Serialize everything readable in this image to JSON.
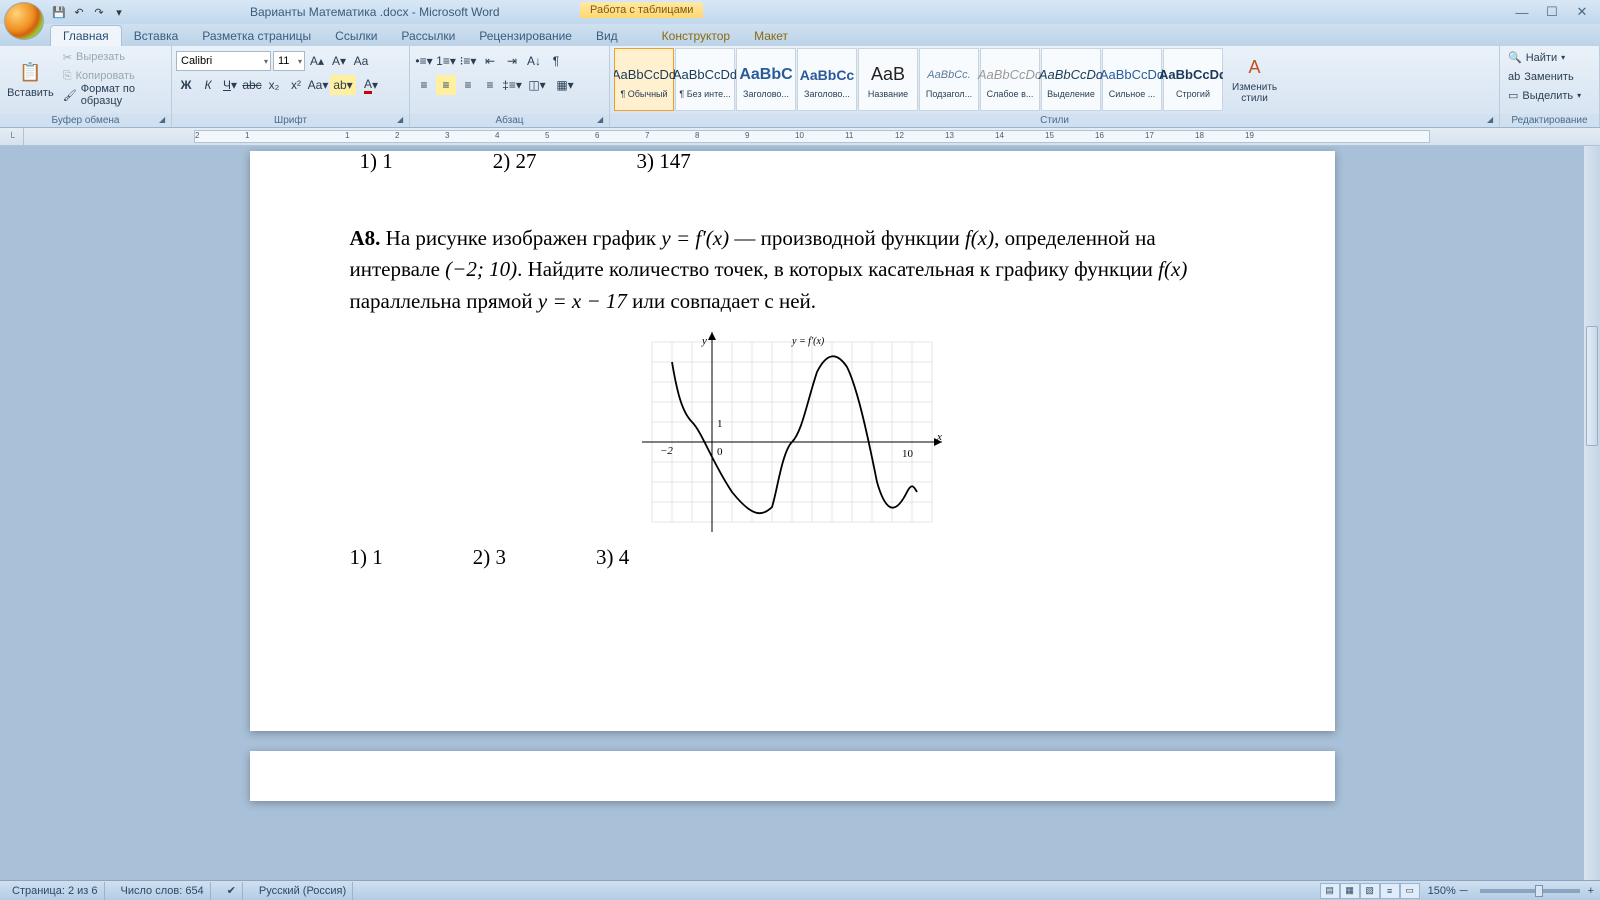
{
  "titlebar": {
    "doc_title": "Варианты Математика .docx - Microsoft Word",
    "table_tools": "Работа с таблицами"
  },
  "tabs": {
    "home": "Главная",
    "insert": "Вставка",
    "page_layout": "Разметка страницы",
    "references": "Ссылки",
    "mailings": "Рассылки",
    "review": "Рецензирование",
    "view": "Вид",
    "design": "Конструктор",
    "layout": "Макет"
  },
  "ribbon": {
    "paste": "Вставить",
    "cut": "Вырезать",
    "copy": "Копировать",
    "format_painter": "Формат по образцу",
    "clipboard_label": "Буфер обмена",
    "font_name": "Calibri",
    "font_size": "11",
    "font_label": "Шрифт",
    "para_label": "Абзац",
    "styles_label": "Стили",
    "change_styles": "Изменить\nстили",
    "find": "Найти",
    "replace": "Заменить",
    "select": "Выделить",
    "editing_label": "Редактирование",
    "styles": [
      {
        "preview": "AaBbCcDd",
        "name": "¶ Обычный",
        "cls": ""
      },
      {
        "preview": "AaBbCcDd",
        "name": "¶ Без инте...",
        "cls": ""
      },
      {
        "preview": "AaBbC",
        "name": "Заголово...",
        "cls": "h1"
      },
      {
        "preview": "AaBbCc",
        "name": "Заголово...",
        "cls": "h2"
      },
      {
        "preview": "AaB",
        "name": "Название",
        "cls": "title"
      },
      {
        "preview": "AaBbCc.",
        "name": "Подзагол...",
        "cls": "sub"
      },
      {
        "preview": "AaBbCcDd",
        "name": "Слабое в...",
        "cls": "faint"
      },
      {
        "preview": "AaBbCcDd",
        "name": "Выделение",
        "cls": "emph"
      },
      {
        "preview": "AaBbCcDd",
        "name": "Сильное ...",
        "cls": "strong"
      },
      {
        "preview": "AaBbCcDd",
        "name": "Строгий",
        "cls": "strict"
      }
    ]
  },
  "ruler_marks": [
    "2",
    "1",
    "",
    "1",
    "2",
    "3",
    "4",
    "5",
    "6",
    "7",
    "8",
    "9",
    "10",
    "11",
    "12",
    "13",
    "14",
    "15",
    "16",
    "17",
    "18",
    "19"
  ],
  "document": {
    "top_fragments": [
      "1) 1",
      "2) 27",
      "3) 147"
    ],
    "task_label": "A8.",
    "task_text_1": " На рисунке изображен график ",
    "eq1": "y = f′(x)",
    "task_text_2": " — производной функции ",
    "eq2": "f(x)",
    "task_text_3": ", определенной на интервале ",
    "interval": "(−2; 10)",
    "task_text_4": ". Найдите количество точек, в которых касательная к графику функции ",
    "eq3": "f(x)",
    "task_text_5": " параллельна прямой ",
    "eq4": "y = x − 17",
    "task_text_6": " или совпадает с ней.",
    "graph_label_y": "y",
    "graph_label_x": "x",
    "graph_label_fn": "y = f′(x)",
    "graph_tick_neg2": "−2",
    "graph_tick_1": "1",
    "graph_tick_0": "0",
    "graph_tick_10": "10",
    "answers": [
      "1) 1",
      "2) 3",
      "3) 4"
    ]
  },
  "status": {
    "page": "Страница: 2 из 6",
    "words": "Число слов: 654",
    "lang": "Русский (Россия)",
    "zoom": "150%"
  },
  "chart_data": {
    "type": "line",
    "title": "y = f′(x)",
    "xlabel": "x",
    "ylabel": "y",
    "xlim": [
      -2,
      10
    ],
    "ylim": [
      -5,
      5
    ],
    "x_ticks": [
      -2,
      0,
      10
    ],
    "y_ticks": [
      0,
      1
    ],
    "series": [
      {
        "name": "f′(x)",
        "x": [
          -2,
          -1.5,
          -1,
          0,
          1,
          2,
          3,
          3.8,
          4.5,
          5.2,
          6,
          7,
          7.8,
          8.5,
          9,
          9.5,
          10
        ],
        "y": [
          4,
          2.5,
          1,
          -1,
          -3,
          -4.5,
          -4.2,
          -2,
          0,
          2,
          4,
          4.5,
          2,
          -1,
          -3.5,
          -3,
          -1
        ]
      }
    ]
  }
}
